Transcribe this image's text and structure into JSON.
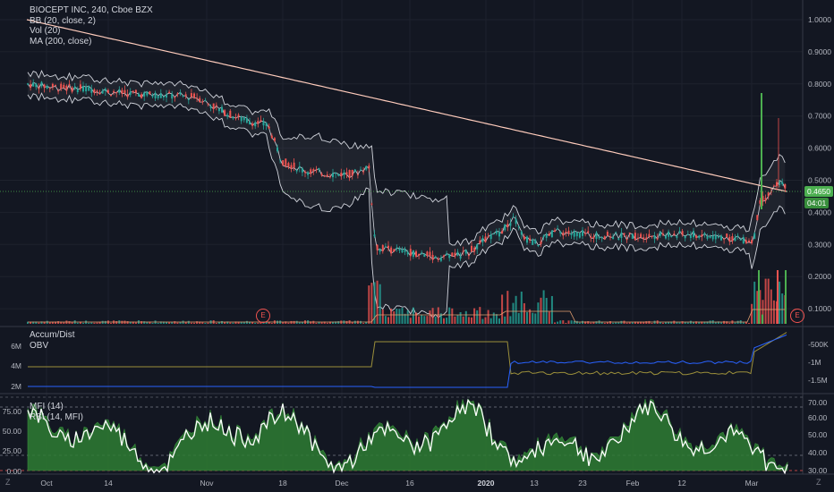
{
  "legend": {
    "title": "BIOCEPT INC, 240, Cboe BZX",
    "bb": "BB (20, close, 2)",
    "vol": "Vol (20)",
    "ma": "MA (200, close)"
  },
  "pane2_legend": {
    "ad": "Accum/Dist",
    "obv": "OBV"
  },
  "pane3_legend": {
    "mfi": "MFI (14)",
    "rsi": "RSI (14, MFI)"
  },
  "price_axis": [
    "1.0000",
    "0.9000",
    "0.8000",
    "0.7000",
    "0.6000",
    "0.5000",
    "0.4000",
    "0.3000",
    "0.2000",
    "0.1000"
  ],
  "current_price": "0.4650",
  "countdown": "04:01",
  "pane2_left_axis": [
    "6M",
    "4M",
    "2M"
  ],
  "pane2_right_axis": [
    "-500K",
    "-1M",
    "-1.5M"
  ],
  "pane3_left_axis": [
    "75.00",
    "50.00",
    "25.00",
    "0.00"
  ],
  "pane3_right_axis": [
    "70.00",
    "60.00",
    "50.00",
    "40.00",
    "30.00"
  ],
  "date_axis": [
    "Oct",
    "14",
    "Nov",
    "18",
    "Dec",
    "16",
    "2020",
    "13",
    "23",
    "Feb",
    "12",
    "Mar"
  ],
  "earnings_badge": "E",
  "corner_left": "Z",
  "corner_right": "Z",
  "colors": {
    "up": "#26a69a",
    "down": "#ef5350",
    "ma": "#ffccbc",
    "bb": "#d1d4dc",
    "price_line": "#4caf50",
    "obv": "#2962ff",
    "ad": "#9b8f3a",
    "mfi_fill": "#2e7d32",
    "rsi": "#ffffff"
  }
}
